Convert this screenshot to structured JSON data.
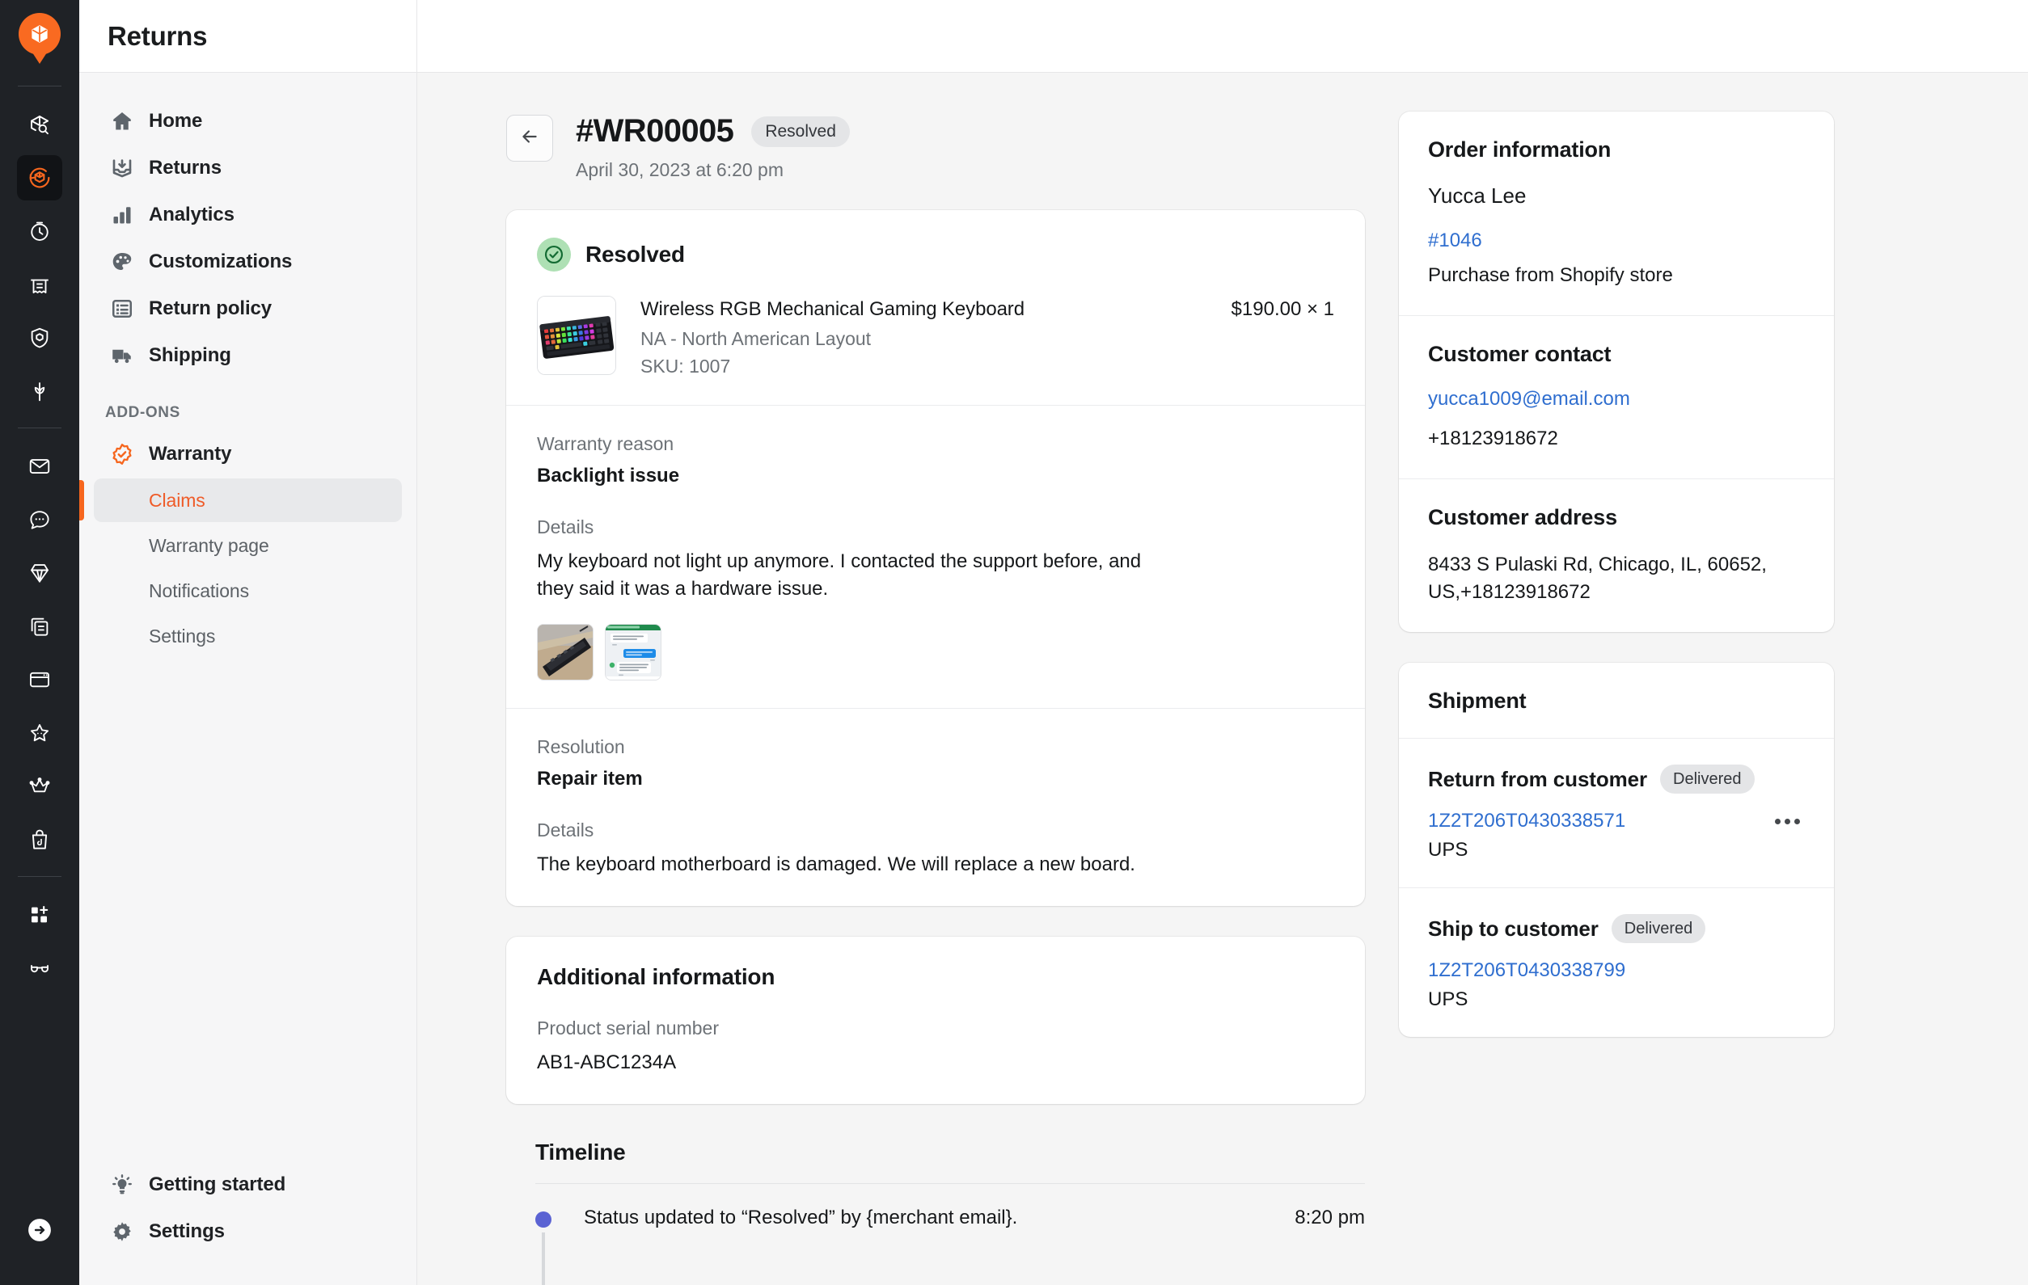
{
  "app": {
    "header_title": "Returns",
    "logo_icon": "box-pin-logo-icon"
  },
  "rail": {
    "items": [
      {
        "icon": "box-search-icon",
        "active": false
      },
      {
        "icon": "returns-cycle-icon",
        "active": true
      },
      {
        "icon": "clock-icon",
        "active": false
      },
      {
        "icon": "receipt-printer-icon",
        "active": false
      },
      {
        "icon": "shield-box-icon",
        "active": false
      },
      {
        "icon": "sprout-icon",
        "active": false
      },
      {
        "icon": "envelope-icon",
        "active": false
      },
      {
        "icon": "chat-bubble-icon",
        "active": false
      },
      {
        "icon": "diamond-icon",
        "active": false
      },
      {
        "icon": "copy-documents-icon",
        "active": false
      },
      {
        "icon": "browser-window-icon",
        "active": false
      },
      {
        "icon": "star-icon",
        "active": false
      },
      {
        "icon": "crown-icon",
        "active": false
      },
      {
        "icon": "shopping-bag-icon",
        "active": false
      },
      {
        "icon": "add-app-icon",
        "active": false
      },
      {
        "icon": "glasses-icon",
        "active": false
      }
    ],
    "collapse_icon": "arrow-right-circle-icon"
  },
  "sidenav": {
    "items": [
      {
        "label": "Home",
        "icon": "home-icon"
      },
      {
        "label": "Returns",
        "icon": "returns-inbox-icon"
      },
      {
        "label": "Analytics",
        "icon": "analytics-bars-icon"
      },
      {
        "label": "Customizations",
        "icon": "palette-icon"
      },
      {
        "label": "Return policy",
        "icon": "list-icon"
      },
      {
        "label": "Shipping",
        "icon": "truck-icon"
      }
    ],
    "section_title": "ADD-ONS",
    "addon": {
      "label": "Warranty",
      "icon": "warranty-badge-icon"
    },
    "sub_items": [
      {
        "label": "Claims",
        "active": true
      },
      {
        "label": "Warranty page",
        "active": false
      },
      {
        "label": "Notifications",
        "active": false
      },
      {
        "label": "Settings",
        "active": false
      }
    ],
    "footer": [
      {
        "label": "Getting started",
        "icon": "lightbulb-icon"
      },
      {
        "label": "Settings",
        "icon": "gear-icon"
      }
    ]
  },
  "claim": {
    "back_icon": "arrow-left-icon",
    "id": "#WR00005",
    "status_badge": "Resolved",
    "date": "April 30, 2023 at 6:20 pm",
    "status_title": "Resolved",
    "status_icon": "check-circle-icon",
    "product": {
      "title": "Wireless RGB Mechanical Gaming Keyboard",
      "variant": "NA - North American Layout",
      "sku": "SKU: 1007",
      "price": "$190.00 × 1",
      "thumb_icon": "rgb-keyboard-photo"
    },
    "warranty_reason_label": "Warranty reason",
    "warranty_reason_value": "Backlight issue",
    "details_label": "Details",
    "details_value": "My keyboard not light up anymore. I contacted the support before, and they said it was a hardware issue.",
    "attachments": [
      {
        "name": "keyboard-photo-attachment"
      },
      {
        "name": "chat-screenshot-attachment"
      }
    ],
    "resolution_label": "Resolution",
    "resolution_value": "Repair item",
    "resolution_details_label": "Details",
    "resolution_details_value": "The keyboard motherboard is damaged. We will replace a new board."
  },
  "additional": {
    "title": "Additional information",
    "serial_label": "Product serial number",
    "serial_value": "AB1-ABC1234A"
  },
  "timeline": {
    "title": "Timeline",
    "entries": [
      {
        "text": "Status updated to “Resolved” by {merchant email}.",
        "time": "8:20 pm"
      }
    ]
  },
  "order": {
    "title": "Order information",
    "customer_name": "Yucca Lee",
    "order_number": "#1046",
    "source": "Purchase from Shopify store",
    "contact_title": "Customer contact",
    "email": "yucca1009@email.com",
    "phone": "+18123918672",
    "address_title": "Customer address",
    "address": "8433 S Pulaski Rd, Chicago, IL, 60652, US,+18123918672"
  },
  "shipment": {
    "title": "Shipment",
    "legs": [
      {
        "label": "Return from customer",
        "status": "Delivered",
        "tracking": "1Z2T206T0430338571",
        "carrier": "UPS",
        "has_menu": true,
        "menu_icon": "more-horizontal-icon"
      },
      {
        "label": "Ship to customer",
        "status": "Delivered",
        "tracking": "1Z2T206T0430338799",
        "carrier": "UPS",
        "has_menu": false
      }
    ]
  },
  "colors": {
    "brand_orange": "#f6661e",
    "link_blue": "#2f6ecf",
    "rail_dark": "#1f2226",
    "status_green": "#aee0b4",
    "timeline_dot": "#5b63d3"
  }
}
